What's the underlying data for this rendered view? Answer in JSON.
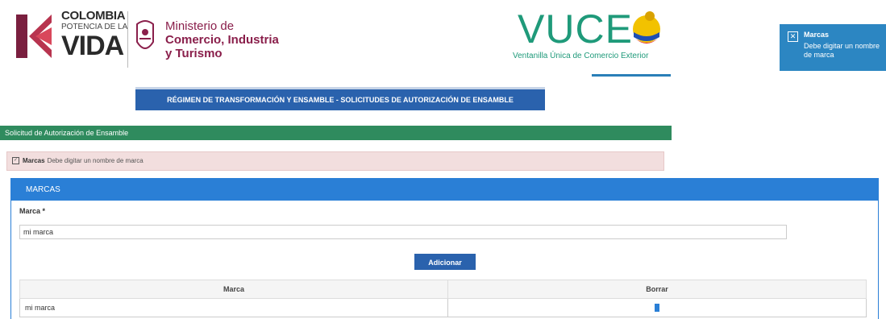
{
  "header": {
    "colombia": {
      "line1": "COLOMBIA",
      "line2": "POTENCIA DE LA",
      "line3": "VIDA"
    },
    "ministerio": {
      "line1": "Ministerio de",
      "line2": "Comercio, Industria",
      "line3": "y Turismo"
    },
    "vuce": {
      "title": "VUCE",
      "subtitle": "Ventanilla Única de Comercio Exterior"
    }
  },
  "toast": {
    "title": "Marcas",
    "message": "Debe digitar un nombre de marca"
  },
  "banner": "RÉGIMEN DE TRANSFORMACIÓN Y ENSAMBLE - SOLICITUDES DE AUTORIZACIÓN DE ENSAMBLE",
  "section_title": "Solicitud de Autorización de Ensamble",
  "alert": {
    "title": "Marcas",
    "message": "Debe digitar un nombre de marca"
  },
  "panel": {
    "title": "MARCAS",
    "field_label": "Marca *",
    "field_value": "mi marca",
    "add_button": "Adicionar"
  },
  "table": {
    "headers": [
      "Marca",
      "Borrar"
    ],
    "rows": [
      {
        "marca": "mi marca"
      }
    ]
  },
  "colors": {
    "primary_blue": "#2a7fd6",
    "section_green": "#2f8b5e",
    "alert_pink": "#f2dede",
    "toast_blue": "#2c86c2"
  }
}
